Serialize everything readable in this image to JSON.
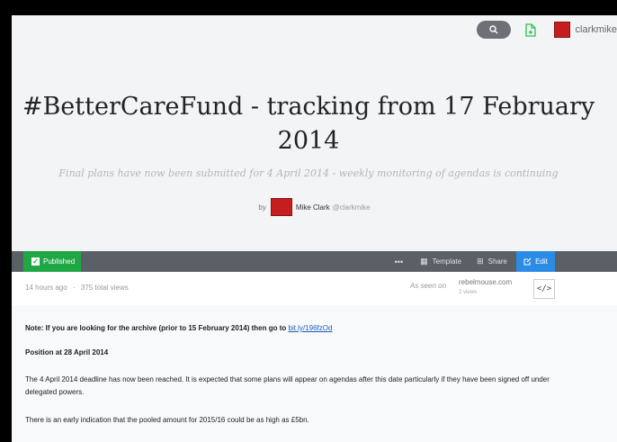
{
  "topbar": {
    "username": "clarkmike"
  },
  "article": {
    "title": "#BetterCareFund - tracking from 17 February 2014",
    "subtitle": "Final plans have now been submitted for 4 April 2014 - weekly monitoring of agendas is continuing",
    "by_label": "by",
    "author_name": "Mike Clark",
    "author_handle": "@clarkmike"
  },
  "toolbar": {
    "published_label": "Published",
    "more_label": "•••",
    "template_label": "Template",
    "share_label": "Share",
    "edit_label": "Edit"
  },
  "meta": {
    "time_ago": "14 hours ago",
    "separator": "·",
    "views": "375 total views",
    "as_seen_label": "As seen on",
    "source_name": "rebelmouse.com",
    "source_views": "2 views",
    "embed_label": "</>"
  },
  "body": {
    "note_text": "Note: If you are looking for the archive (prior to 15 February 2014) then go to ",
    "note_link": "bit.ly/196fzOd",
    "position_heading": "Position at 28 April 2014",
    "para1": "The 4 April 2014 deadline has now been reached. It is expected that some plans will appear on agendas after this date particularly if they have been signed off under delegated powers.",
    "para2": "There is an early indication that the pooled amount for 2015/16 could be as high as £5bn."
  },
  "colors": {
    "published": "#20a745",
    "edit": "#2b8ce6",
    "toolbar": "#5b5f66"
  }
}
